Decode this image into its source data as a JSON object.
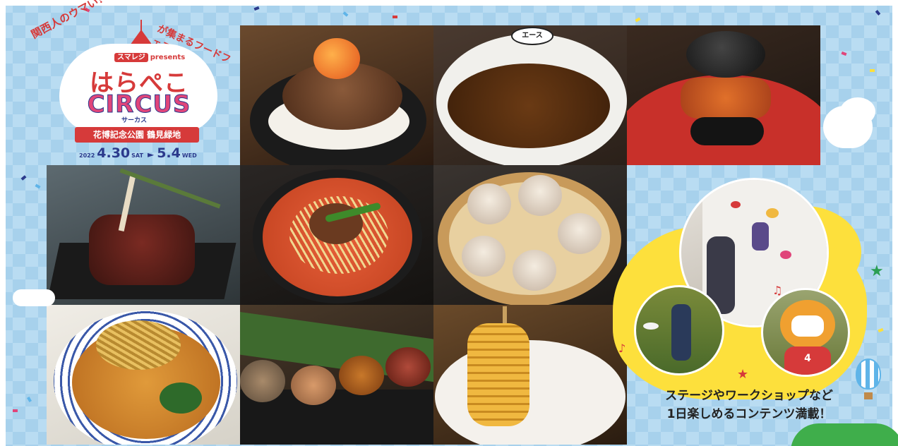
{
  "logo": {
    "arc_left": "関西人のウマい！",
    "arc_right": "が集まるフードフェス",
    "sponsor_tag": "スマレジ",
    "sponsor_suffix": "presents",
    "title_jp": "はらぺこ",
    "title_en": "CIRCUS",
    "title_kana": "サーカス",
    "venue": "花博記念公園 鶴見緑地",
    "year": "2022",
    "start_date": "4.30",
    "start_dow": "SAT",
    "end_date": "5.4",
    "end_dow": "WED"
  },
  "caption": {
    "line1": "ステージやワークショップなど",
    "line2": "1日楽しめるコンテンツ満載！"
  },
  "curry_sign": "エース",
  "mascot_number": "4",
  "colors": {
    "brand_red": "#d63a3a",
    "brand_navy": "#2b3a8c",
    "accent_yellow": "#fde03c",
    "background_blue": "#b9dcf2"
  }
}
